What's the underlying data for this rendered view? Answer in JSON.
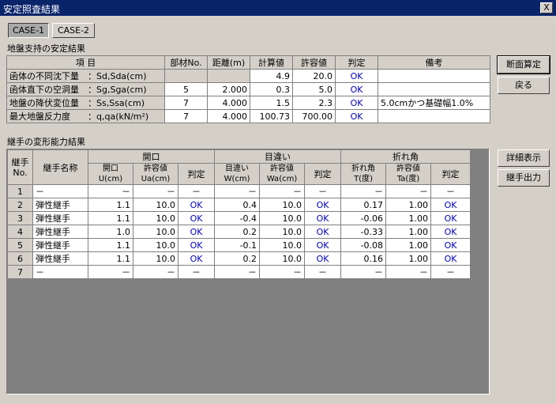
{
  "window": {
    "title": "安定照査結果",
    "close_label": "X"
  },
  "tabs": [
    {
      "label": "CASE-1"
    },
    {
      "label": "CASE-2"
    }
  ],
  "section1": {
    "title": "地盤支持の安定結果",
    "headers": [
      "項 目",
      "部材No.",
      "距離(m)",
      "計算値",
      "許容値",
      "判定",
      "備考"
    ],
    "rows": [
      {
        "item": "函体の不同沈下量　：Sd,Sda(cm)",
        "member": "",
        "dist": "",
        "calc": "4.9",
        "allow": "20.0",
        "judge": "OK",
        "note": ""
      },
      {
        "item": "函体直下の空洞量　：Sg,Sga(cm)",
        "member": "5",
        "dist": "2.000",
        "calc": "0.3",
        "allow": "5.0",
        "judge": "OK",
        "note": ""
      },
      {
        "item": "地盤の降伏変位量　：Ss,Ssa(cm)",
        "member": "7",
        "dist": "4.000",
        "calc": "1.5",
        "allow": "2.3",
        "judge": "OK",
        "note": "5.0cmかつ基礎幅1.0%"
      },
      {
        "item": "最大地盤反力度　　：q,qa(kN/m²)",
        "member": "7",
        "dist": "4.000",
        "calc": "100.73",
        "allow": "700.00",
        "judge": "OK",
        "note": ""
      }
    ]
  },
  "section2": {
    "title": "継手の変形能力結果",
    "col_no": "継手No.",
    "col_name": "継手名称",
    "groups": [
      "開口",
      "目違い",
      "折れ角"
    ],
    "subheaders": [
      "開口U(cm)",
      "許容値Ua(cm)",
      "判定",
      "目違いW(cm)",
      "許容値Wa(cm)",
      "判定",
      "折れ角T(度)",
      "許容値Ta(度)",
      "判定"
    ],
    "rows": [
      {
        "no": "1",
        "name": "－",
        "v": [
          "－",
          "－",
          "－",
          "－",
          "－",
          "－",
          "－",
          "－",
          "－"
        ]
      },
      {
        "no": "2",
        "name": "弾性継手",
        "v": [
          "1.1",
          "10.0",
          "OK",
          "0.4",
          "10.0",
          "OK",
          "0.17",
          "1.00",
          "OK"
        ]
      },
      {
        "no": "3",
        "name": "弾性継手",
        "v": [
          "1.1",
          "10.0",
          "OK",
          "-0.4",
          "10.0",
          "OK",
          "-0.06",
          "1.00",
          "OK"
        ]
      },
      {
        "no": "4",
        "name": "弾性継手",
        "v": [
          "1.0",
          "10.0",
          "OK",
          "0.2",
          "10.0",
          "OK",
          "-0.33",
          "1.00",
          "OK"
        ]
      },
      {
        "no": "5",
        "name": "弾性継手",
        "v": [
          "1.1",
          "10.0",
          "OK",
          "-0.1",
          "10.0",
          "OK",
          "-0.08",
          "1.00",
          "OK"
        ]
      },
      {
        "no": "6",
        "name": "弾性継手",
        "v": [
          "1.1",
          "10.0",
          "OK",
          "0.2",
          "10.0",
          "OK",
          "0.16",
          "1.00",
          "OK"
        ]
      },
      {
        "no": "7",
        "name": "－",
        "v": [
          "－",
          "－",
          "－",
          "－",
          "－",
          "－",
          "－",
          "－",
          "－"
        ]
      }
    ]
  },
  "buttons": {
    "section_check": "断面算定",
    "back": "戻る",
    "detail": "詳細表示",
    "joint_output": "継手出力"
  }
}
